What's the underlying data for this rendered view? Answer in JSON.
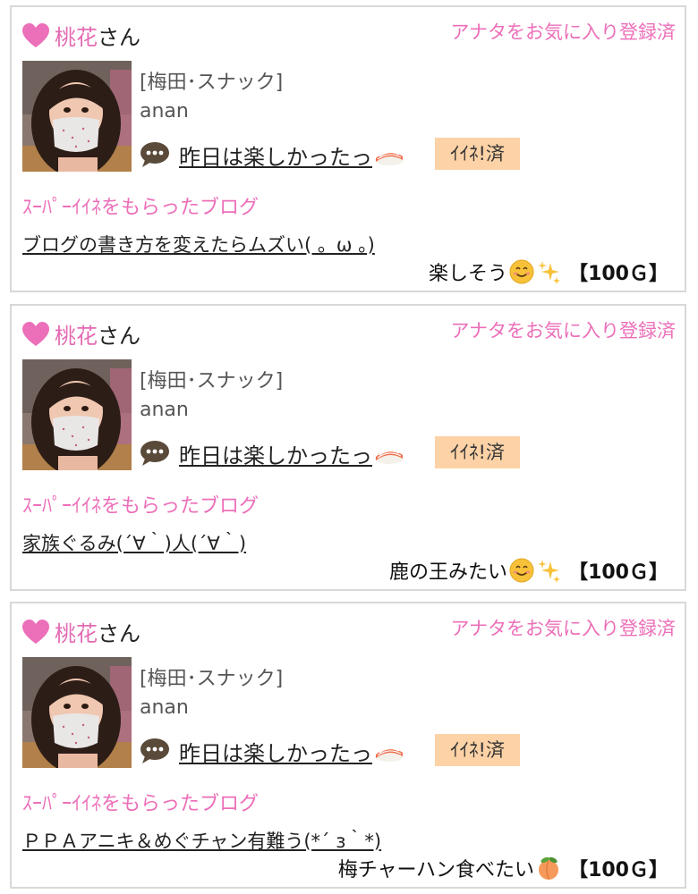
{
  "cards": [
    {
      "user_name": "桃花",
      "user_suffix": "さん",
      "fav_status": "アナタをお気に入り登録済",
      "shop": "[梅田･スナック]",
      "cast": "anan",
      "comment": "昨日は楽しかったっ",
      "comment_emoji": "sushi-icon",
      "iine_badge": "ｲｲﾈ!済",
      "super_label": "ｽｰﾊﾟｰｲｲﾈをもらったブログ",
      "blog_title": "ブログの書き方を変えたらムズい( 。ω 。)",
      "reply": "楽しそう",
      "reply_icons": [
        "smile-icon",
        "sparkles-icon"
      ],
      "points": "【100Ｇ】"
    },
    {
      "user_name": "桃花",
      "user_suffix": "さん",
      "fav_status": "アナタをお気に入り登録済",
      "shop": "[梅田･スナック]",
      "cast": "anan",
      "comment": "昨日は楽しかったっ",
      "comment_emoji": "sushi-icon",
      "iine_badge": "ｲｲﾈ!済",
      "super_label": "ｽｰﾊﾟｰｲｲﾈをもらったブログ",
      "blog_title": "家族ぐるみ(´∀｀)人(´∀｀)",
      "reply": "鹿の王みたい",
      "reply_icons": [
        "smile-icon",
        "sparkles-icon"
      ],
      "points": "【100Ｇ】"
    },
    {
      "user_name": "桃花",
      "user_suffix": "さん",
      "fav_status": "アナタをお気に入り登録済",
      "shop": "[梅田･スナック]",
      "cast": "anan",
      "comment": "昨日は楽しかったっ",
      "comment_emoji": "sushi-icon",
      "iine_badge": "ｲｲﾈ!済",
      "super_label": "ｽｰﾊﾟｰｲｲﾈをもらったブログ",
      "blog_title": "ＰＰＡアニキ＆めぐチャン有難う(*´ з｀*)",
      "reply": "梅チャーハン食べたい",
      "reply_icons": [
        "peach-icon"
      ],
      "points": "【100Ｇ】"
    }
  ],
  "colors": {
    "pink": "#ec6fb9",
    "badge_bg": "#fcd2a6",
    "border": "#d8d8d8"
  }
}
